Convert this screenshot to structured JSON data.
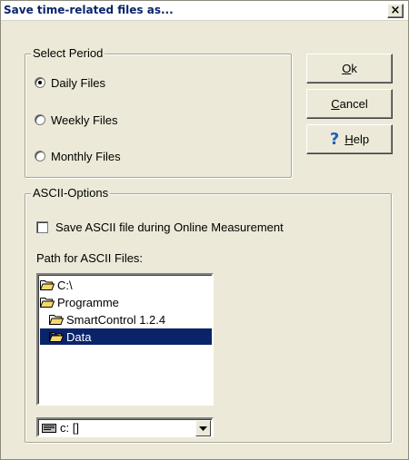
{
  "window": {
    "title": "Save time-related files as...",
    "close_glyph": "×",
    "close_icon": "close-icon"
  },
  "period_group": {
    "title": "Select Period",
    "options": [
      {
        "label": "Daily Files",
        "checked": true
      },
      {
        "label": "Weekly Files",
        "checked": false
      },
      {
        "label": "Monthly Files",
        "checked": false
      }
    ]
  },
  "buttons": {
    "ok_mnemonic": "O",
    "ok_rest": "k",
    "cancel_mnemonic": "C",
    "cancel_rest": "ancel",
    "help_mnemonic": "H",
    "help_rest": "elp",
    "help_icon_glyph": "?",
    "help_icon": "question-mark-icon"
  },
  "ascii_group": {
    "title": "ASCII-Options",
    "checkbox_label": "Save ASCII file during Online Measurement",
    "checkbox_checked": false,
    "path_label": "Path for ASCII Files:"
  },
  "directories": [
    {
      "label": "C:\\",
      "icon": "open-folder-icon",
      "selected": false
    },
    {
      "label": "Programme",
      "icon": "open-folder-icon",
      "selected": false
    },
    {
      "label": "SmartControl 1.2.4",
      "icon": "open-folder-icon",
      "selected": false
    },
    {
      "label": "Data",
      "icon": "open-folder-icon",
      "selected": true
    }
  ],
  "drive": {
    "value": "c: []",
    "icon": "drive-icon",
    "dropdown_icon": "chevron-down-icon"
  },
  "colors": {
    "dialog_bg": "#ece9d8",
    "title_text": "#0a246a",
    "selection_bg": "#0a246a",
    "folder_yellow": "#f5d76e"
  }
}
